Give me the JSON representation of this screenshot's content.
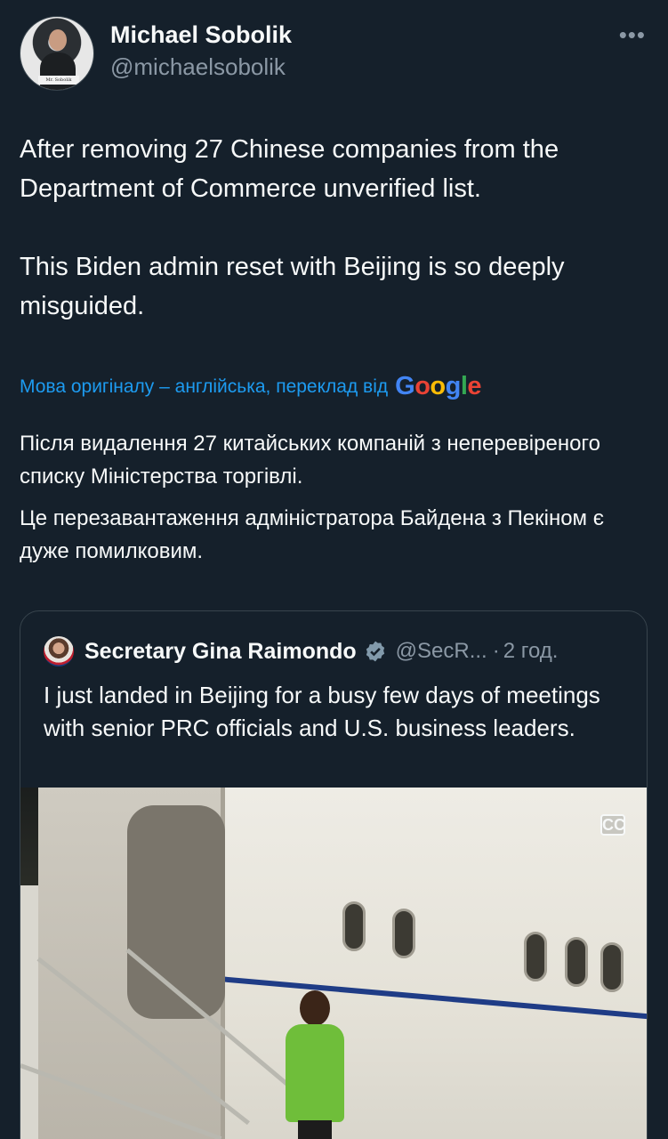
{
  "author": {
    "name": "Michael Sobolik",
    "handle": "@michaelsobolik",
    "avatar_plate": "Mr. Sobolik",
    "more_icon": "more-dots-icon"
  },
  "tweet": {
    "paragraphs": [
      "After removing 27 Chinese companies from the Department of Commerce unverified list.",
      "This Biden admin reset with Beijing is so deeply misguided."
    ]
  },
  "translation": {
    "label": "Мова оригіналу – англійська, переклад від",
    "provider": "Google",
    "paragraphs": [
      "Після видалення 27 китайських компаній з неперевіреного списку Міністерства торгівлі.",
      "Це перезавантаження адміністратора Байдена з Пекіном є дуже помилковим."
    ]
  },
  "quoted_tweet": {
    "name": "Secretary Gina Raimondo",
    "verified_icon": "verified-badge-icon",
    "handle": "@SecR...",
    "separator": "·",
    "time": "2 год.",
    "text": "I just landed in Beijing for a busy few days of meetings with senior PRC officials and U.S. business leaders.",
    "media_caption_icon": "closed-captions-off-icon"
  },
  "colors": {
    "background": "#15202b",
    "link": "#1d9bf0",
    "muted": "#8b98a5",
    "border": "#38444d",
    "verified": "#829aab"
  }
}
